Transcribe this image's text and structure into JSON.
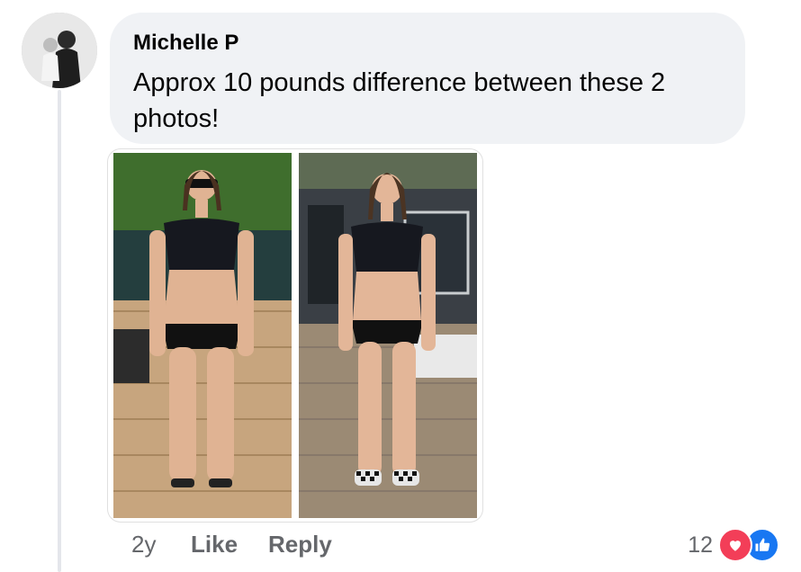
{
  "comment": {
    "author": "Michelle P",
    "text": "Approx 10 pounds difference between these 2 photos!",
    "age": "2y",
    "like_label": "Like",
    "reply_label": "Reply",
    "reaction_count": "12",
    "reaction_icons": [
      "heart-icon",
      "thumbs-up-icon"
    ]
  },
  "colors": {
    "bubble": "#f0f2f5",
    "meta_text": "#65676b",
    "love": "#f33e58",
    "like": "#1877f2"
  }
}
